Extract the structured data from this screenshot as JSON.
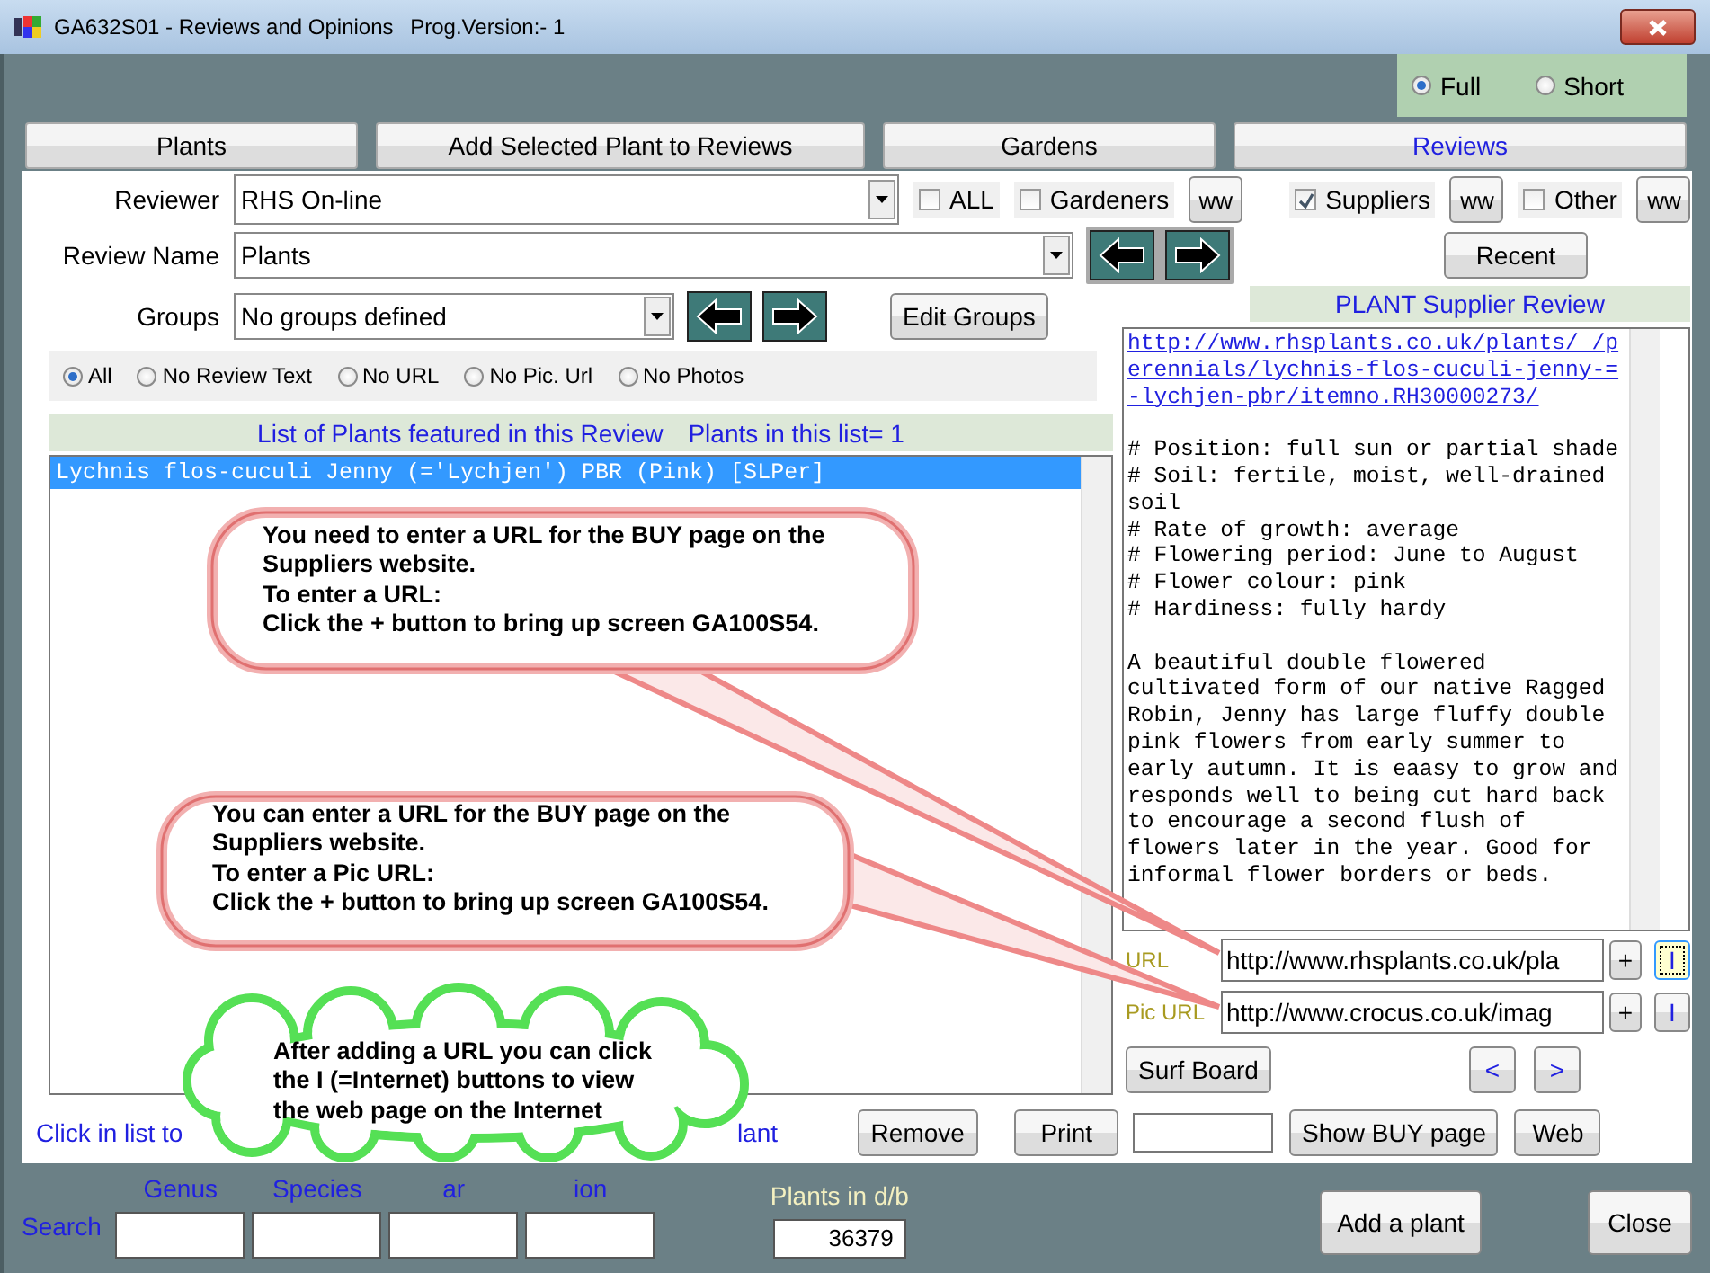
{
  "window": {
    "title": "GA632S01 - Reviews and Opinions",
    "version": "Prog.Version:- 1"
  },
  "view_mode": [
    {
      "label": "Full",
      "selected": true
    },
    {
      "label": "Short",
      "selected": false
    }
  ],
  "tabs": [
    {
      "label": "Plants",
      "selected": false
    },
    {
      "label": "Add Selected Plant to Reviews",
      "selected": false
    },
    {
      "label": "Gardens",
      "selected": false
    },
    {
      "label": "Reviews",
      "selected": true
    }
  ],
  "reviewer": {
    "label": "Reviewer",
    "value": "RHS On-line"
  },
  "reviewer_types": [
    {
      "label": "ALL",
      "checked": false
    },
    {
      "label": "Gardeners",
      "checked": false,
      "button": "ww"
    },
    {
      "label": "Suppliers",
      "checked": true,
      "button": "ww"
    },
    {
      "label": "Other",
      "checked": false,
      "button": "ww"
    }
  ],
  "review_name": {
    "label": "Review Name",
    "value": "Plants"
  },
  "recent_button": "Recent",
  "groups": {
    "label": "Groups",
    "value": "No groups defined"
  },
  "edit_groups_button": "Edit Groups",
  "list_filters": [
    {
      "label": "All",
      "selected": true
    },
    {
      "label": "No Review Text",
      "selected": false
    },
    {
      "label": "No URL",
      "selected": false
    },
    {
      "label": "No Pic. Url",
      "selected": false
    },
    {
      "label": "No Photos",
      "selected": false
    }
  ],
  "plant_list": {
    "heading": "List of Plants featured in this Review",
    "count": "Plants in this list= 1",
    "items": [
      {
        "text": "Lychnis flos-cuculi Jenny (='Lychjen') PBR (Pink) [SLPer]",
        "selected": true
      }
    ]
  },
  "hint": [
    "Click in list to",
    "lant"
  ],
  "remove_button": "Remove",
  "print_button": "Print",
  "review_panel": {
    "heading": "PLANT Supplier Review",
    "link": "http://www.rhsplants.co.uk/plants/ /perennials/lychnis-flos-cuculi-jenny-=-lychjen-pbr/itemno.RH30000273/",
    "lines": [
      "# Position: full sun or partial shade",
      "# Soil: fertile, moist, well-drained soil",
      "# Rate of growth: average",
      "# Flowering period: June to August",
      "# Flower colour: pink",
      "# Hardiness: fully hardy"
    ],
    "paragraph": "A beautiful double flowered cultivated form of our native Ragged Robin, Jenny has large fluffy double pink flowers from early summer to early autumn. It is eaasy to grow and responds well to being cut hard back to encourage a second flush of flowers later in the year. Good for informal flower borders or beds."
  },
  "url_fields": [
    {
      "label": "URL",
      "value": "http://www.rhsplants.co.uk/pla",
      "add": "+",
      "open": "I",
      "focused": true
    },
    {
      "label": "Pic URL",
      "value": "http://www.crocus.co.uk/imag",
      "add": "+",
      "open": "I",
      "focused": false
    }
  ],
  "surf_board_button": "Surf Board",
  "nav_buttons": [
    "<",
    ">"
  ],
  "show_buy_button": "Show BUY page",
  "web_button": "Web",
  "search": {
    "label": "Search",
    "fields": [
      {
        "label": "Genus"
      },
      {
        "label": "Species"
      },
      {
        "label": "ar"
      },
      {
        "label": "ion"
      }
    ]
  },
  "db_count": {
    "label": "Plants in d/b",
    "value": "36379"
  },
  "add_plant_button": "Add a plant",
  "close_button": "Close",
  "callouts": [
    {
      "kind": "speech",
      "text": "You need to enter a URL for the BUY page on the\nSuppliers website.\nTo enter a URL:\nClick the + button to bring up screen GA100S54."
    },
    {
      "kind": "speech",
      "text": "You can enter a URL for the BUY page on the\nSuppliers website.\nTo enter a Pic URL:\nClick the + button to bring up screen GA100S54."
    },
    {
      "kind": "cloud",
      "text": "After adding a URL you can click\nthe I (=Internet) buttons to view\nthe web page on the Internet"
    }
  ]
}
